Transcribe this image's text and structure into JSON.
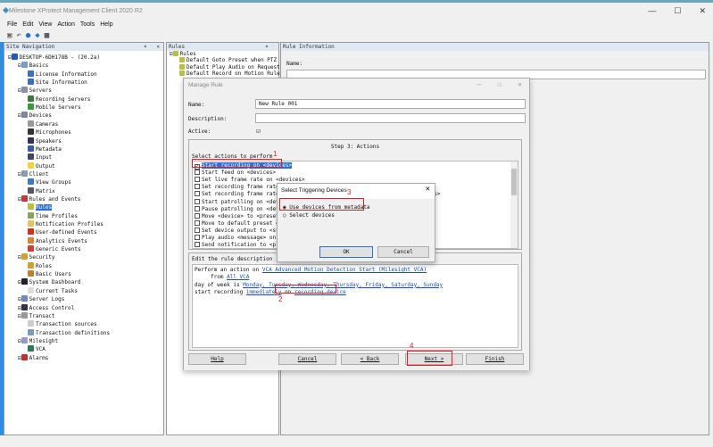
{
  "app": {
    "title": "Milestone XProtect Management Client 2020 R2",
    "menu": [
      "File",
      "Edit",
      "View",
      "Action",
      "Tools",
      "Help"
    ],
    "toolbar_icons": [
      "save-icon",
      "undo-icon",
      "help-icon",
      "connect-icon",
      "tools-icon"
    ]
  },
  "site_nav": {
    "title": "Site Navigation",
    "controls": "▾ ᛫ ✕",
    "tree": [
      {
        "label": "DESKTOP-6DH178B - (20.2a)",
        "level": 0,
        "color": "#1e5bbf"
      },
      {
        "label": "Basics",
        "level": 1,
        "color": "#7a9cc8"
      },
      {
        "label": "License Information",
        "level": 2,
        "color": "#3b6fc4"
      },
      {
        "label": "Site Information",
        "level": 2,
        "color": "#3b6fc4"
      },
      {
        "label": "Servers",
        "level": 1,
        "color": "#8a8fa8"
      },
      {
        "label": "Recording Servers",
        "level": 2,
        "color": "#3a7a3a"
      },
      {
        "label": "Mobile Servers",
        "level": 2,
        "color": "#3a9a3a"
      },
      {
        "label": "Devices",
        "level": 1,
        "color": "#7a8aa0"
      },
      {
        "label": "Cameras",
        "level": 2,
        "color": "#999"
      },
      {
        "label": "Microphones",
        "level": 2,
        "color": "#333"
      },
      {
        "label": "Speakers",
        "level": 2,
        "color": "#335"
      },
      {
        "label": "Metadata",
        "level": 2,
        "color": "#3a5ab0"
      },
      {
        "label": "Input",
        "level": 2,
        "color": "#446"
      },
      {
        "label": "Output",
        "level": 2,
        "color": "#f2d43a"
      },
      {
        "label": "Client",
        "level": 1,
        "color": "#8a9ab0"
      },
      {
        "label": "View Groups",
        "level": 2,
        "color": "#3a7ac8"
      },
      {
        "label": "Matrix",
        "level": 2,
        "color": "#556"
      },
      {
        "label": "Rules and Events",
        "level": 1,
        "color": "#c03a3a"
      },
      {
        "label": "Rules",
        "level": 2,
        "color": "#b8c040",
        "selected": true
      },
      {
        "label": "Time Profiles",
        "level": 2,
        "color": "#8aa060"
      },
      {
        "label": "Notification Profiles",
        "level": 2,
        "color": "#e8c060"
      },
      {
        "label": "User-defined Events",
        "level": 2,
        "color": "#d03020"
      },
      {
        "label": "Analytics Events",
        "level": 2,
        "color": "#e08030"
      },
      {
        "label": "Generic Events",
        "level": 2,
        "color": "#d04030"
      },
      {
        "label": "Security",
        "level": 1,
        "color": "#d0a030"
      },
      {
        "label": "Roles",
        "level": 2,
        "color": "#d0a030"
      },
      {
        "label": "Basic Users",
        "level": 2,
        "color": "#c08030"
      },
      {
        "label": "System Dashboard",
        "level": 1,
        "color": "#222"
      },
      {
        "label": "Current Tasks",
        "level": 2,
        "color": "#ddd"
      },
      {
        "label": "Server Logs",
        "level": 1,
        "color": "#6a8ac0"
      },
      {
        "label": "Access Control",
        "level": 1,
        "color": "#334"
      },
      {
        "label": "Transact",
        "level": 1,
        "color": "#999"
      },
      {
        "label": "Transaction sources",
        "level": 2,
        "color": "#ccc"
      },
      {
        "label": "Transaction definitions",
        "level": 2,
        "color": "#7a9ac0"
      },
      {
        "label": "Milesight",
        "level": 1,
        "color": "#9a9ac8"
      },
      {
        "label": "VCA",
        "level": 2,
        "color": "#2a7a5a"
      },
      {
        "label": "Alarms",
        "level": 1,
        "color": "#c03030"
      }
    ]
  },
  "rules_panel": {
    "title": "Rules",
    "controls": "▾ ᛫",
    "root": "Rules",
    "items": [
      "Default Goto Preset when PTZ is",
      "Default Play Audio on Request B",
      "Default Record on Motion Rule"
    ]
  },
  "rule_info": {
    "title": "Rule Information",
    "name_label": "Name:"
  },
  "manage_rule": {
    "title": "Manage Rule",
    "name_label": "Name:",
    "name_value": "New Rule 001",
    "description_label": "Description:",
    "description_value": "",
    "active_label": "Active:",
    "active": true,
    "step_title": "Step 3: Actions",
    "select_label": "Select actions to perform",
    "actions": [
      {
        "label": "Start recording on <devices>",
        "checked": true,
        "selected": true
      },
      {
        "label": "Start feed on <devices>",
        "checked": false
      },
      {
        "label": "Set live frame rate on <devices>",
        "checked": false
      },
      {
        "label": "Set recording frame rate on <devices>",
        "checked": false
      },
      {
        "label": "Set recording frame rate to all frames for MPEG-4/H.264/H.265 on <devices>",
        "checked": false
      },
      {
        "label": "Start patrolling on <device> using <profile> with PTZ <priority>",
        "checked": false
      },
      {
        "label": "Pause patrolling on <devices>",
        "checked": false
      },
      {
        "label": "Move <device> to <preset> position with PTZ <priority>",
        "checked": false
      },
      {
        "label": "Move to default preset on <devices> with PTZ <priority>",
        "checked": false
      },
      {
        "label": "Set device output to <state>",
        "checked": false
      },
      {
        "label": "Play audio <message> on <devices> with <priority>",
        "checked": false
      },
      {
        "label": "Send notification to <profile>",
        "checked": false
      }
    ],
    "edit_label": "Edit the rule description (click an underlined item)",
    "desc_lines": [
      {
        "text": "Perform an action on ",
        "link": "VCA Advanced Motion Detection Start (Milesight VCA)",
        "indent": false
      },
      {
        "text": "from ",
        "link": "All VCA",
        "indent": true
      },
      {
        "text": "day of week is ",
        "link": "Monday, Tuesday, Wednesday, Thursday, Friday, Saturday, Sunday",
        "indent": false
      },
      {
        "text": "start recording ",
        "link": "immediately",
        "mid": " on ",
        "link2": "recording device",
        "indent": false
      }
    ],
    "buttons": {
      "help": "Help",
      "cancel": "Cancel",
      "back": "< Back",
      "next": "Next >",
      "finish": "Finish"
    }
  },
  "trigger_dialog": {
    "title": "Select Triggering Devices",
    "options": [
      {
        "label": "Use devices from metadata",
        "selected": true
      },
      {
        "label": "Select devices",
        "selected": false
      }
    ],
    "ok": "OK",
    "cancel": "Cancel"
  },
  "annotations": [
    "1",
    "2",
    "3",
    "4"
  ],
  "colors": {
    "accent": "#2d6fd2",
    "highlight": "#e02020",
    "link": "#1a4fb5"
  }
}
